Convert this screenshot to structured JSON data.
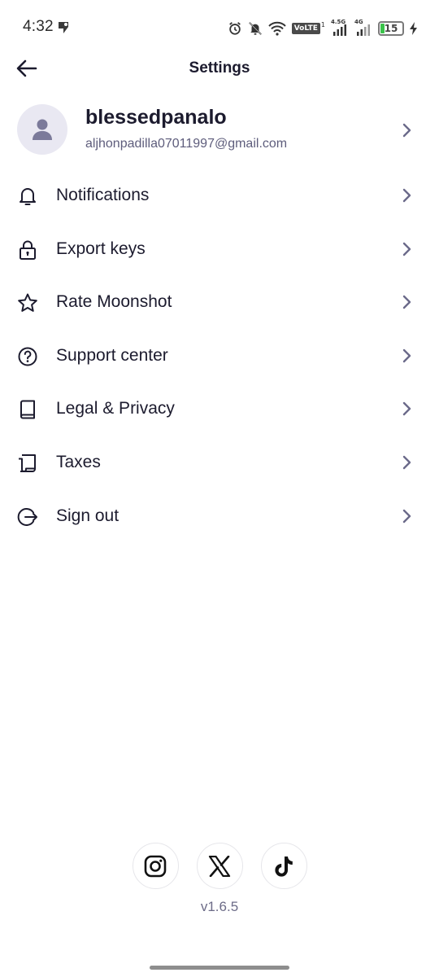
{
  "status_bar": {
    "time": "4:32",
    "network_label_1": "VoLTE",
    "sim_label": "1",
    "sig1_label": "4.5G",
    "sig2_label": "4G",
    "battery": "15"
  },
  "header": {
    "title": "Settings"
  },
  "profile": {
    "name": "blessedpanalo",
    "email": "aljhonpadilla07011997@gmail.com"
  },
  "menu": {
    "items": [
      {
        "label": "Notifications",
        "icon": "bell-icon"
      },
      {
        "label": "Export keys",
        "icon": "lock-icon"
      },
      {
        "label": "Rate Moonshot",
        "icon": "star-icon"
      },
      {
        "label": "Support center",
        "icon": "question-icon"
      },
      {
        "label": "Legal & Privacy",
        "icon": "book-icon"
      },
      {
        "label": "Taxes",
        "icon": "receipt-icon"
      },
      {
        "label": "Sign out",
        "icon": "sign-out-icon"
      }
    ]
  },
  "footer": {
    "socials": [
      "instagram-icon",
      "x-icon",
      "tiktok-icon"
    ],
    "version": "v1.6.5"
  },
  "colors": {
    "text": "#1c1b2e",
    "muted": "#5e5d7c",
    "chevron": "#6b6a8a",
    "avatar_bg": "#e9e8f2",
    "battery_green": "#3ac24a"
  }
}
